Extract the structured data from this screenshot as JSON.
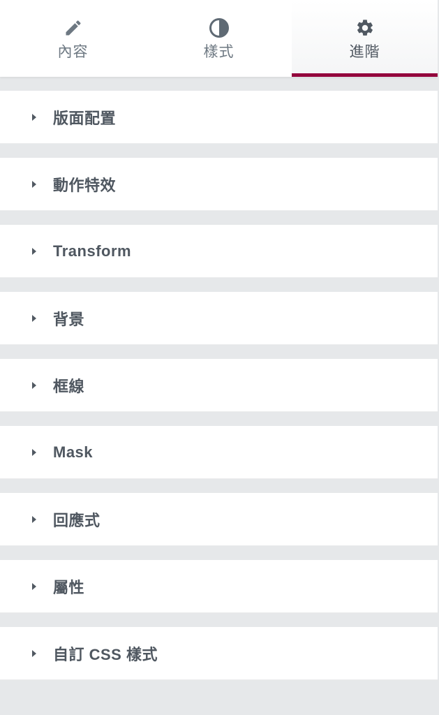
{
  "tabs": [
    {
      "label": "內容",
      "icon": "pencil-icon",
      "active": false
    },
    {
      "label": "樣式",
      "icon": "half-circle-contrast-icon",
      "active": false
    },
    {
      "label": "進階",
      "icon": "gear-icon",
      "active": true
    }
  ],
  "sections": [
    {
      "title": "版面配置"
    },
    {
      "title": "動作特效"
    },
    {
      "title": "Transform"
    },
    {
      "title": "背景"
    },
    {
      "title": "框線"
    },
    {
      "title": "Mask"
    },
    {
      "title": "回應式"
    },
    {
      "title": "屬性"
    },
    {
      "title": "自訂 CSS 樣式"
    }
  ],
  "colors": {
    "active_tab_indicator": "#93003c",
    "panel_background": "#e6e8ea",
    "section_background": "#ffffff",
    "text": "#515962"
  }
}
